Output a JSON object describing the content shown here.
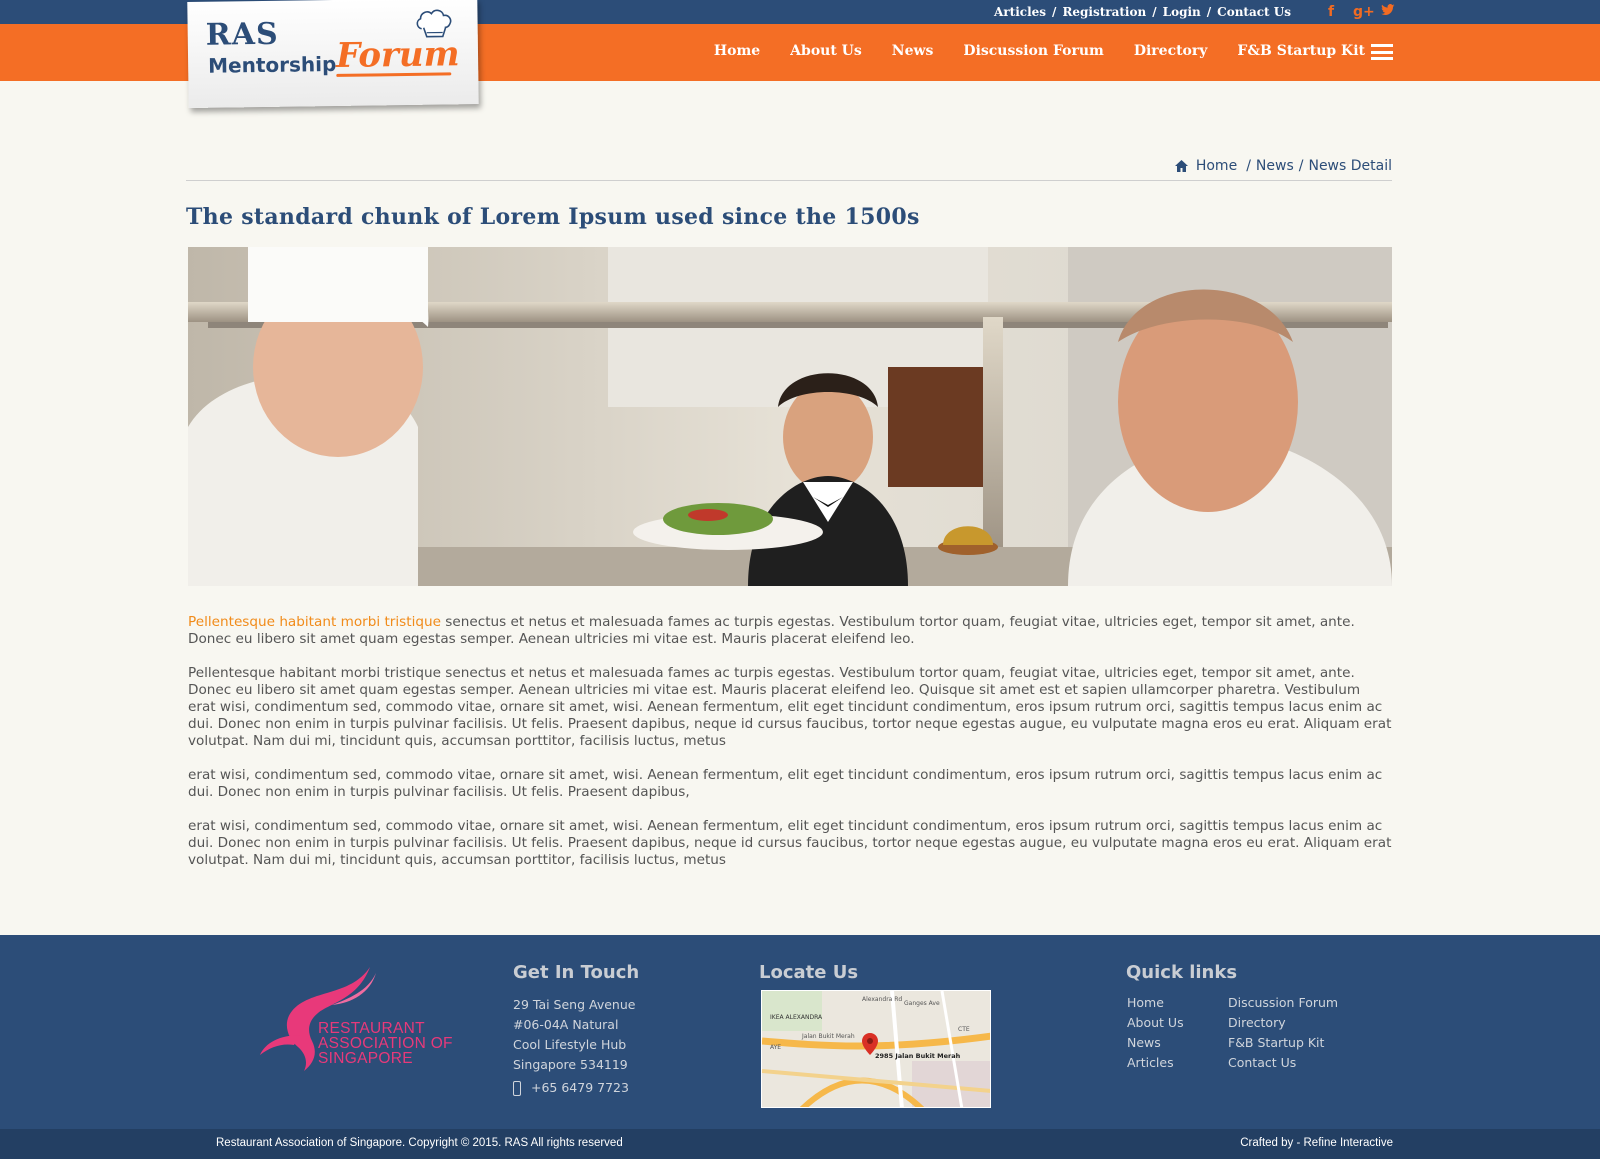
{
  "top_links": {
    "articles": "Articles",
    "registration": "Registration",
    "login": "Login",
    "contact": "Contact Us",
    "separator": "/"
  },
  "social": {
    "facebook": "f",
    "googleplus": "g+",
    "twitter": "t"
  },
  "logo": {
    "ras": "RAS",
    "mentorship": "Mentorship",
    "forum": "Forum"
  },
  "nav": {
    "items": [
      "Home",
      "About Us",
      "News",
      "Discussion Forum",
      "Directory",
      "F&B Startup Kit"
    ]
  },
  "breadcrumb": {
    "home": "Home",
    "news": "News",
    "current": "News Detail",
    "separator": "/"
  },
  "article": {
    "title": "The standard chunk of Lorem Ipsum used since the 1500s",
    "lead_highlight": "Pellentesque habitant morbi tristique",
    "lead_rest": " senectus et netus et malesuada fames ac turpis egestas. Vestibulum tortor quam, feugiat vitae, ultricies eget, tempor sit amet, ante. Donec eu libero sit amet quam egestas semper. Aenean ultricies mi vitae est. Mauris placerat eleifend leo.",
    "paragraphs": [
      "Pellentesque habitant morbi tristique senectus et netus et malesuada fames ac turpis egestas. Vestibulum tortor quam, feugiat vitae, ultricies eget, tempor sit amet, ante. Donec eu libero sit amet quam egestas semper. Aenean ultricies mi vitae est. Mauris placerat eleifend leo. Quisque sit amet est et sapien ullamcorper pharetra. Vestibulum erat wisi, condimentum sed, commodo vitae, ornare sit amet, wisi. Aenean fermentum, elit eget tincidunt condimentum, eros ipsum rutrum orci, sagittis tempus lacus enim ac dui. Donec non enim in turpis pulvinar facilisis. Ut felis. Praesent dapibus, neque id cursus faucibus, tortor neque egestas augue, eu vulputate magna eros eu erat. Aliquam erat volutpat. Nam dui mi, tincidunt quis, accumsan porttitor, facilisis luctus, metus",
      "erat wisi, condimentum sed, commodo vitae, ornare sit amet, wisi. Aenean fermentum, elit eget tincidunt condimentum, eros ipsum rutrum orci, sagittis tempus lacus enim ac dui. Donec non enim in turpis pulvinar facilisis. Ut felis. Praesent dapibus,",
      "erat wisi, condimentum sed, commodo vitae, ornare sit amet, wisi. Aenean fermentum, elit eget tincidunt condimentum, eros ipsum rutrum orci, sagittis tempus lacus enim ac dui. Donec non enim in turpis pulvinar facilisis. Ut felis. Praesent dapibus, neque id cursus faucibus, tortor neque egestas augue, eu vulputate magna eros eu erat. Aliquam erat volutpat. Nam dui mi, tincidunt quis, accumsan porttitor, facilisis luctus, metus"
    ]
  },
  "footer": {
    "ras_logo_lines": [
      "RESTAURANT",
      "ASSOCIATION OF",
      "SINGAPORE"
    ],
    "get_in_touch": {
      "title": "Get In Touch",
      "address": [
        "29 Tai Seng Avenue",
        "#06-04A Natural",
        "Cool Lifestyle Hub",
        "Singapore 534119"
      ],
      "phone": "+65 6479 7723"
    },
    "locate_us": {
      "title": "Locate Us",
      "map_labels": [
        "Alexandra Rd",
        "Ganges Ave",
        "IKEA ALEXANDRA",
        "Jalan Bukit Merah",
        "2985 Jalan Bukit Merah",
        "AYE",
        "CTE"
      ]
    },
    "quick_links": {
      "title": "Quick links",
      "col1": [
        "Home",
        "About Us",
        "News",
        "Articles"
      ],
      "col2": [
        "Discussion Forum",
        "Directory",
        "F&B Startup Kit",
        "Contact Us"
      ]
    },
    "copyright": "Restaurant Association of Singapore. Copyright © 2015. RAS All rights reserved",
    "crafted": "Crafted by - Refine Interactive"
  },
  "colors": {
    "navy": "#2c4d78",
    "orange": "#f46e25",
    "accent_text": "#f18b1a",
    "ras_pink": "#e8397a"
  }
}
